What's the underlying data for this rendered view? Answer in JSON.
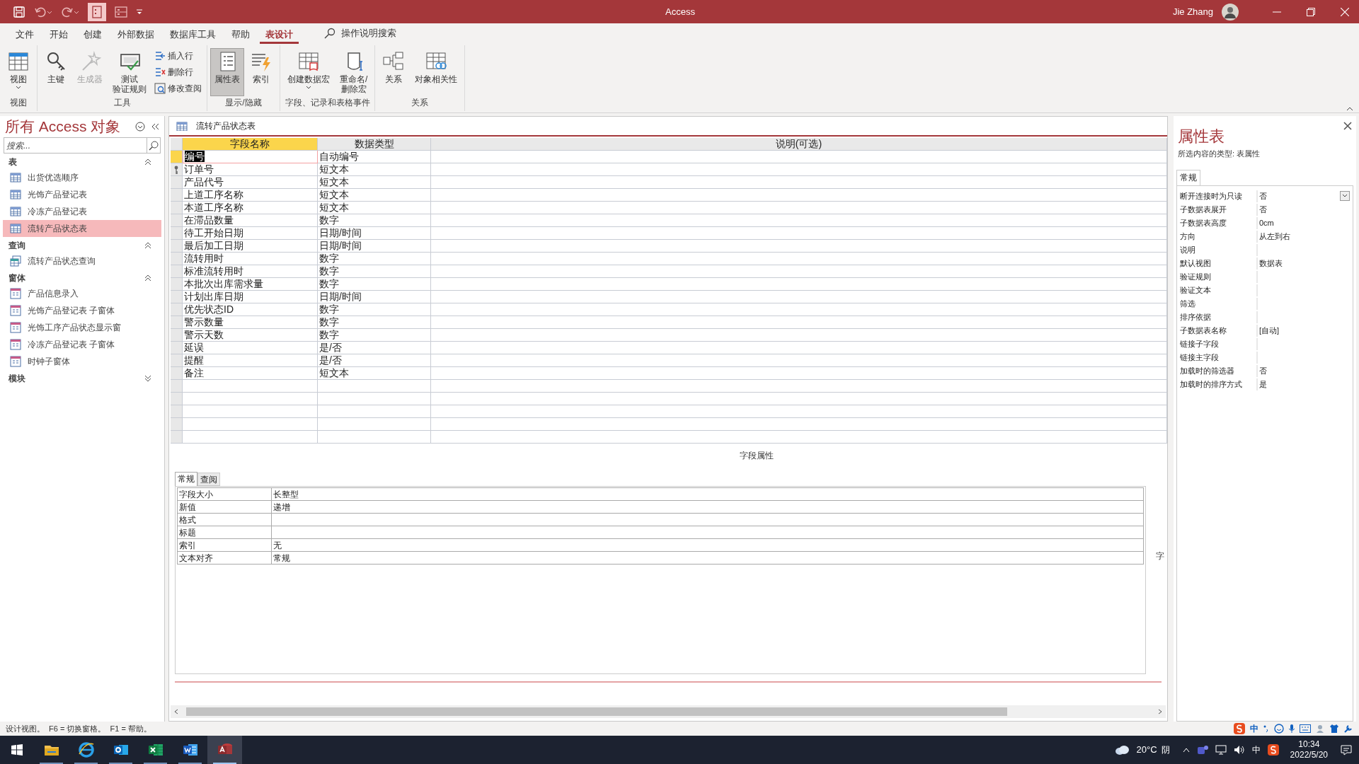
{
  "window": {
    "title": "Access",
    "user": "Jie Zhang"
  },
  "menu_tabs": [
    {
      "label": "文件",
      "selected": false
    },
    {
      "label": "开始",
      "selected": false
    },
    {
      "label": "创建",
      "selected": false
    },
    {
      "label": "外部数据",
      "selected": false
    },
    {
      "label": "数据库工具",
      "selected": false
    },
    {
      "label": "帮助",
      "selected": false
    },
    {
      "label": "表设计",
      "selected": true
    }
  ],
  "tell_me": {
    "placeholder": "操作说明搜索"
  },
  "ribbon_groups": [
    {
      "label": "视图",
      "buttons": [
        {
          "kind": "large",
          "lines": [
            "视图"
          ],
          "dropdown": true,
          "disabled": false,
          "pressed": false
        }
      ]
    },
    {
      "label": "工具",
      "buttons": [
        {
          "kind": "large",
          "lines": [
            "主键"
          ],
          "dropdown": false,
          "disabled": false,
          "pressed": false
        },
        {
          "kind": "large",
          "lines": [
            "生成器"
          ],
          "dropdown": false,
          "disabled": true,
          "pressed": false
        },
        {
          "kind": "large",
          "lines": [
            "测试",
            "验证规则"
          ],
          "dropdown": false,
          "disabled": false,
          "pressed": false
        },
        {
          "kind": "small",
          "lines": [
            "插入行"
          ],
          "dropdown": false,
          "disabled": false,
          "pressed": false
        },
        {
          "kind": "small",
          "lines": [
            "删除行"
          ],
          "dropdown": false,
          "disabled": false,
          "pressed": false
        },
        {
          "kind": "small",
          "lines": [
            "修改查阅"
          ],
          "dropdown": false,
          "disabled": false,
          "pressed": false
        }
      ]
    },
    {
      "label": "显示/隐藏",
      "buttons": [
        {
          "kind": "large",
          "lines": [
            "属性表"
          ],
          "dropdown": false,
          "disabled": false,
          "pressed": true
        },
        {
          "kind": "large",
          "lines": [
            "索引"
          ],
          "dropdown": false,
          "disabled": false,
          "pressed": false
        }
      ]
    },
    {
      "label": "字段、记录和表格事件",
      "buttons": [
        {
          "kind": "large",
          "lines": [
            "创建数据宏"
          ],
          "dropdown": true,
          "disabled": false,
          "pressed": false
        },
        {
          "kind": "large",
          "lines": [
            "重命名/",
            "删除宏"
          ],
          "dropdown": false,
          "disabled": false,
          "pressed": false
        }
      ]
    },
    {
      "label": "关系",
      "buttons": [
        {
          "kind": "large",
          "lines": [
            "关系"
          ],
          "dropdown": false,
          "disabled": false,
          "pressed": false
        },
        {
          "kind": "large",
          "lines": [
            "对象相关性"
          ],
          "dropdown": false,
          "disabled": false,
          "pressed": false
        }
      ]
    }
  ],
  "navigation": {
    "title": "所有 Access 对象",
    "search": {
      "placeholder": "搜索..."
    },
    "groups": [
      {
        "label": "表",
        "expanded": true,
        "items": [
          {
            "label": "出货优选顺序",
            "kind": "table",
            "selected": false
          },
          {
            "label": "光饰产品登记表",
            "kind": "table",
            "selected": false
          },
          {
            "label": "冷冻产品登记表",
            "kind": "table",
            "selected": false
          },
          {
            "label": "流转产品状态表",
            "kind": "table",
            "selected": true
          }
        ]
      },
      {
        "label": "查询",
        "expanded": true,
        "items": [
          {
            "label": "流转产品状态查询",
            "kind": "query",
            "selected": false
          }
        ]
      },
      {
        "label": "窗体",
        "expanded": true,
        "items": [
          {
            "label": "产品信息录入",
            "kind": "form",
            "selected": false
          },
          {
            "label": "光饰产品登记表 子窗体",
            "kind": "form",
            "selected": false
          },
          {
            "label": "光饰工序产品状态显示窗",
            "kind": "form",
            "selected": false
          },
          {
            "label": "冷冻产品登记表 子窗体",
            "kind": "form",
            "selected": false
          },
          {
            "label": "时钟子窗体",
            "kind": "form",
            "selected": false
          }
        ]
      },
      {
        "label": "模块",
        "expanded": false
      }
    ]
  },
  "document": {
    "tab": "流转产品状态表",
    "columns": [
      {
        "label": "字段名称",
        "selected": true
      },
      {
        "label": "数据类型",
        "selected": false
      },
      {
        "label": "说明(可选)",
        "selected": false
      }
    ],
    "rows": [
      {
        "name": "编号",
        "type": "自动编号",
        "selected": true,
        "primary_key": false
      },
      {
        "name": "订单号",
        "type": "短文本",
        "selected": false,
        "primary_key": true
      },
      {
        "name": "产品代号",
        "type": "短文本",
        "selected": false,
        "primary_key": false
      },
      {
        "name": "上道工序名称",
        "type": "短文本",
        "selected": false,
        "primary_key": false
      },
      {
        "name": "本道工序名称",
        "type": "短文本",
        "selected": false,
        "primary_key": false
      },
      {
        "name": "在滞品数量",
        "type": "数字",
        "selected": false,
        "primary_key": false
      },
      {
        "name": "待工开始日期",
        "type": "日期/时间",
        "selected": false,
        "primary_key": false
      },
      {
        "name": "最后加工日期",
        "type": "日期/时间",
        "selected": false,
        "primary_key": false
      },
      {
        "name": "流转用时",
        "type": "数字",
        "selected": false,
        "primary_key": false
      },
      {
        "name": "标准流转用时",
        "type": "数字",
        "selected": false,
        "primary_key": false
      },
      {
        "name": "本批次出库需求量",
        "type": "数字",
        "selected": false,
        "primary_key": false
      },
      {
        "name": "计划出库日期",
        "type": "日期/时间",
        "selected": false,
        "primary_key": false
      },
      {
        "name": "优先状态ID",
        "type": "数字",
        "selected": false,
        "primary_key": false
      },
      {
        "name": "警示数量",
        "type": "数字",
        "selected": false,
        "primary_key": false
      },
      {
        "name": "警示天数",
        "type": "数字",
        "selected": false,
        "primary_key": false
      },
      {
        "name": "延误",
        "type": "是/否",
        "selected": false,
        "primary_key": false
      },
      {
        "name": "提醒",
        "type": "是/否",
        "selected": false,
        "primary_key": false
      },
      {
        "name": "备注",
        "type": "短文本",
        "selected": false,
        "primary_key": false
      }
    ]
  },
  "field_properties": {
    "title": "字段属性",
    "tabs": [
      {
        "label": "常规",
        "selected": true
      },
      {
        "label": "查阅",
        "selected": false
      }
    ],
    "rows": [
      {
        "label": "字段大小",
        "value": "长整型"
      },
      {
        "label": "新值",
        "value": "递增"
      },
      {
        "label": "格式"
      },
      {
        "label": "标题"
      },
      {
        "label": "索引",
        "value": "无"
      },
      {
        "label": "文本对齐",
        "value": "常规"
      }
    ],
    "side_text": "字"
  },
  "property_sheet": {
    "title": "属性表",
    "selection_type": "所选内容的类型: 表属性",
    "tabs": [
      {
        "label": "常规",
        "selected": true
      }
    ],
    "rows": [
      {
        "label": "断开连接时为只读",
        "value": "否",
        "kind": "dropdown"
      },
      {
        "label": "子数据表展开",
        "value": "否",
        "kind": "text"
      },
      {
        "label": "子数据表高度",
        "value": "0cm",
        "kind": "text"
      },
      {
        "label": "方向",
        "value": "从左到右",
        "kind": "text"
      },
      {
        "label": "说明",
        "kind": "text"
      },
      {
        "label": "默认视图",
        "value": "数据表",
        "kind": "text"
      },
      {
        "label": "验证规则",
        "kind": "text"
      },
      {
        "label": "验证文本",
        "kind": "text"
      },
      {
        "label": "筛选",
        "kind": "text"
      },
      {
        "label": "排序依据",
        "kind": "text"
      },
      {
        "label": "子数据表名称",
        "value": "[自动]",
        "kind": "text"
      },
      {
        "label": "链接子字段",
        "kind": "text"
      },
      {
        "label": "链接主字段",
        "kind": "text"
      },
      {
        "label": "加载时的筛选器",
        "value": "否",
        "kind": "text"
      },
      {
        "label": "加载时的排序方式",
        "value": "是",
        "kind": "text"
      }
    ]
  },
  "status_bar": {
    "text": "设计视图。  F6 = 切换窗格。  F1 = 帮助。",
    "ime": "中"
  },
  "taskbar": {
    "apps": [
      {
        "kind": "explorer",
        "active": false
      },
      {
        "kind": "browser",
        "active": false
      },
      {
        "kind": "outlook",
        "active": false
      },
      {
        "kind": "excel",
        "active": false
      },
      {
        "kind": "word",
        "active": false
      },
      {
        "kind": "access",
        "active": true
      }
    ],
    "temperature": "20°C",
    "weather": "阴",
    "ime": "中",
    "time": "10:34",
    "date": "2022/5/20"
  }
}
